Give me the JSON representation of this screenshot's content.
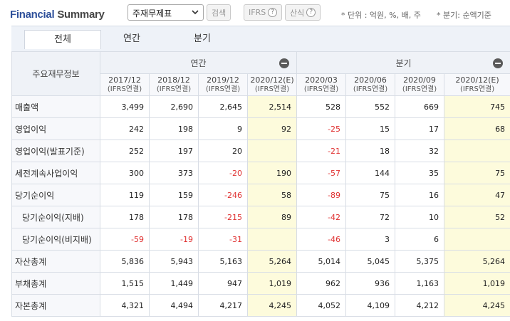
{
  "header": {
    "title_main": "Financial",
    "title_sub": "Summary",
    "select_value": "주재무제표",
    "search_label": "검색",
    "ifrs_label": "IFRS",
    "calc_label": "산식",
    "help_glyph": "?",
    "unit_note": "* 단위 : 억원, %, 배, 주",
    "quarter_note": "* 분기: 순액기준"
  },
  "tabs": [
    "전체",
    "연간",
    "분기"
  ],
  "table": {
    "corner_label": "주요재무정보",
    "group_annual": "연간",
    "group_quarter": "분기",
    "columns": [
      {
        "period": "2017/12",
        "basis": "(IFRS연결)"
      },
      {
        "period": "2018/12",
        "basis": "(IFRS연결)"
      },
      {
        "period": "2019/12",
        "basis": "(IFRS연결)"
      },
      {
        "period": "2020/12(E)",
        "basis": "(IFRS연결)"
      },
      {
        "period": "2020/03",
        "basis": "(IFRS연결)"
      },
      {
        "period": "2020/06",
        "basis": "(IFRS연결)"
      },
      {
        "period": "2020/09",
        "basis": "(IFRS연결)"
      },
      {
        "period": "2020/12(E)",
        "basis": "(IFRS연결)"
      }
    ],
    "rows": [
      {
        "label": "매출액",
        "sub": false,
        "values": [
          "3,499",
          "2,690",
          "2,645",
          "2,514",
          "528",
          "552",
          "669",
          "745"
        ]
      },
      {
        "label": "영업이익",
        "sub": false,
        "values": [
          "242",
          "198",
          "9",
          "92",
          "-25",
          "15",
          "17",
          "68"
        ]
      },
      {
        "label": "영업이익(발표기준)",
        "sub": false,
        "values": [
          "252",
          "197",
          "20",
          "",
          "-21",
          "18",
          "32",
          ""
        ]
      },
      {
        "label": "세전계속사업이익",
        "sub": false,
        "values": [
          "300",
          "373",
          "-20",
          "190",
          "-57",
          "144",
          "35",
          "75"
        ]
      },
      {
        "label": "당기순이익",
        "sub": false,
        "values": [
          "119",
          "159",
          "-246",
          "58",
          "-89",
          "75",
          "16",
          "47"
        ]
      },
      {
        "label": "당기순이익(지배)",
        "sub": true,
        "values": [
          "178",
          "178",
          "-215",
          "89",
          "-42",
          "72",
          "10",
          "52"
        ]
      },
      {
        "label": "당기순이익(비지배)",
        "sub": true,
        "values": [
          "-59",
          "-19",
          "-31",
          "",
          "-46",
          "3",
          "6",
          ""
        ]
      },
      {
        "label": "자산총계",
        "sub": false,
        "values": [
          "5,836",
          "5,943",
          "5,163",
          "5,264",
          "5,014",
          "5,045",
          "5,375",
          "5,264"
        ]
      },
      {
        "label": "부채총계",
        "sub": false,
        "values": [
          "1,515",
          "1,449",
          "947",
          "1,019",
          "962",
          "936",
          "1,163",
          "1,019"
        ]
      },
      {
        "label": "자본총계",
        "sub": false,
        "values": [
          "4,321",
          "4,494",
          "4,217",
          "4,245",
          "4,052",
          "4,109",
          "4,212",
          "4,245"
        ]
      }
    ]
  },
  "colors": {
    "estimate_bg": "#fdfbdc",
    "negative": "#e03131",
    "title_blue": "#2d4f9a"
  }
}
